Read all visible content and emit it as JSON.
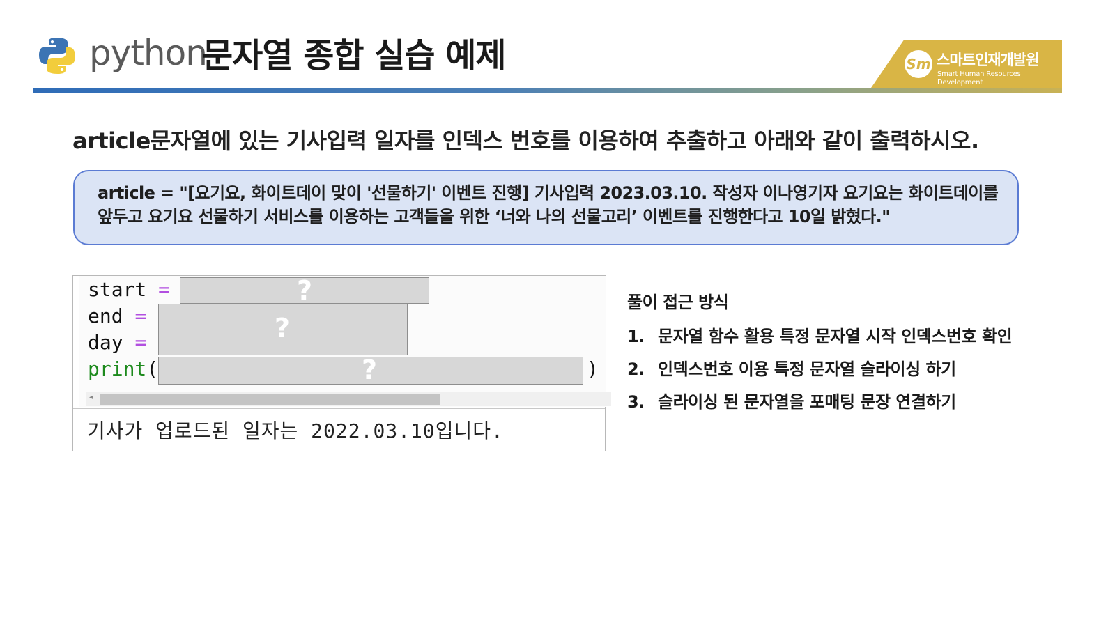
{
  "header": {
    "python_word": "python",
    "title": "문자열 종합 실습 예제",
    "brand": {
      "mark": "Sm",
      "name": "스마트인재개발원",
      "subtitle": "Smart Human Resources Development",
      "color": "#d9b545"
    }
  },
  "question": "article문자열에 있는 기사입력 일자를 인덱스 번호를 이용하여 추출하고 아래와 같이 출력하시오.",
  "article": "article = \"[요기요, 화이트데이 맞이 '선물하기' 이벤트 진행] 기사입력 2023.03.10. 작성자 이나영기자 요기요는 화이트데이를 앞두고 요기요 선물하기 서비스를 이용하는 고객들을 위한 ‘너와 나의 선물고리’ 이벤트를 진행한다고 10일 밝혔다.\"",
  "code": {
    "lines": [
      {
        "var": "start",
        "op": "=",
        "blank": "?"
      },
      {
        "var": "end",
        "op": "=",
        "blank": "?"
      },
      {
        "var": "day",
        "op": "="
      },
      {
        "func": "print",
        "open": "(",
        "blank": "?",
        "close": ")"
      }
    ],
    "output": "기사가 업로드된 일자는 2022.03.10입니다."
  },
  "approach": {
    "title": "풀이 접근 방식",
    "steps": [
      {
        "num": "1.",
        "text": "문자열 함수 활용 특정 문자열 시작 인덱스번호 확인"
      },
      {
        "num": "2.",
        "text": "인덱스번호 이용 특정 문자열 슬라이싱 하기"
      },
      {
        "num": "3.",
        "text": "슬라이싱 된 문자열을 포매팅 문장 연결하기"
      }
    ]
  },
  "colors": {
    "accent_blue": "#2f6cb7",
    "article_bg": "#dbe4f5",
    "article_border": "#5b7bd3",
    "operator": "#b24fe0",
    "function": "#1d8a1d"
  }
}
